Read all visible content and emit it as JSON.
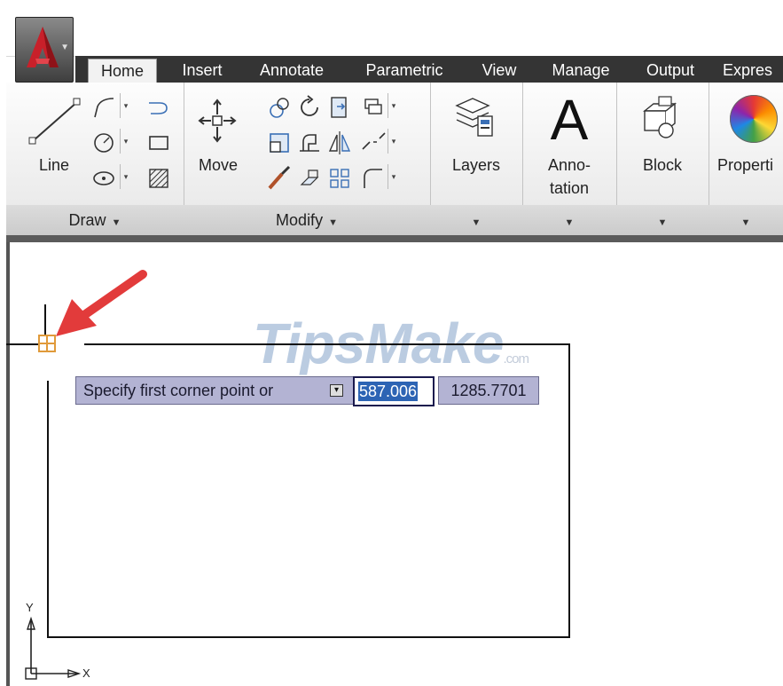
{
  "ribbon": {
    "tabs": [
      "Home",
      "Insert",
      "Annotate",
      "Parametric",
      "View",
      "Manage",
      "Output",
      "Expres"
    ],
    "active_tab": "Home",
    "panels": {
      "draw": {
        "title": "Draw",
        "line_label": "Line"
      },
      "modify": {
        "title": "Modify",
        "move_label": "Move"
      },
      "layers": {
        "label": "Layers"
      },
      "annotation": {
        "big_letter": "A",
        "label_line1": "Anno-",
        "label_line2": "tation"
      },
      "block": {
        "label": "Block"
      },
      "properties": {
        "label": "Properti"
      }
    }
  },
  "drawing": {
    "prompt_text": "Specify first corner point or",
    "coord_x": "587.006",
    "coord_y": "1285.7701",
    "watermark_main": "TipsMake",
    "watermark_suffix": ".com",
    "ucs_y": "Y",
    "ucs_x": "X"
  },
  "colors": {
    "accent_arrow": "#e23b3b",
    "snap_marker": "#e09a3a",
    "prompt_bg": "#b3b3d3",
    "selection": "#2d64b4"
  }
}
